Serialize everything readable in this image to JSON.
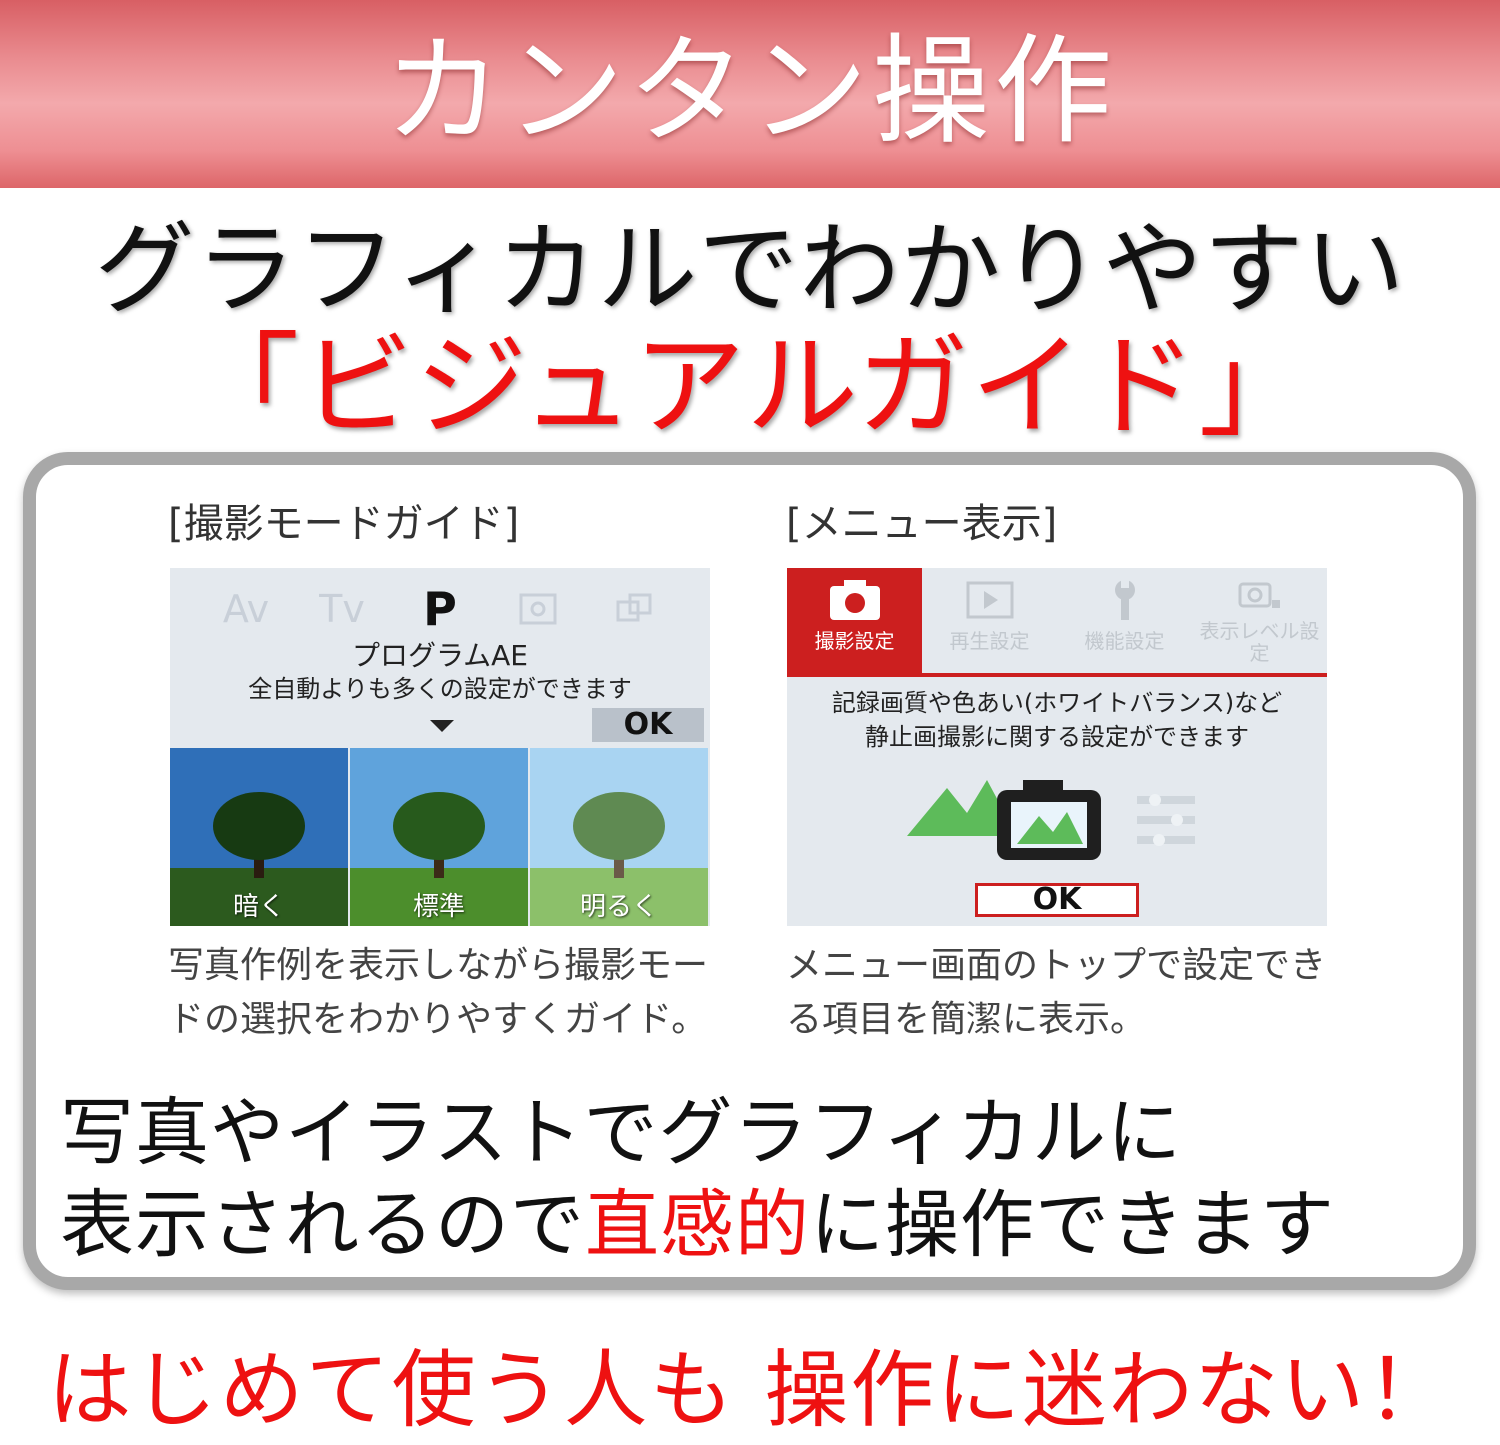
{
  "banner": {
    "title": "カンタン操作"
  },
  "headline": {
    "subtitle": "グラフィカルでわかりやすい",
    "guide_title": "「ビジュアルガイド」"
  },
  "left": {
    "heading": "[撮影モードガイド]",
    "modes": [
      "Av",
      "Tv",
      "P"
    ],
    "active_mode": "P",
    "mode_name": "プログラムAE",
    "mode_desc": "全自動よりも多くの設定ができます",
    "ok": "OK",
    "photos": [
      "暗く",
      "標準",
      "明るく"
    ],
    "caption_line1": "写真作例を表示しながら撮影モー",
    "caption_line2": "ドの選択をわかりやすくガイド。"
  },
  "right": {
    "heading": "[メニュー表示]",
    "tabs": [
      "撮影設定",
      "再生設定",
      "機能設定",
      "表示レベル設定"
    ],
    "desc_line1": "記録画質や色あい(ホワイトバランス)など",
    "desc_line2": "静止画撮影に関する設定ができます",
    "ok": "OK",
    "caption_line1": "メニュー画面のトップで設定でき",
    "caption_line2": "る項目を簡潔に表示。"
  },
  "body_text": {
    "line1": "写真やイラストでグラフィカルに",
    "line2_a": "表示されるので",
    "line2_highlight": "直感的",
    "line2_b": "に操作できます"
  },
  "closing": "はじめて使う人も 操作に迷わない！",
  "colors": {
    "accent_red": "#ee1111",
    "banner_pink": "#e98a8e",
    "panel_border": "#a8a8a8"
  }
}
